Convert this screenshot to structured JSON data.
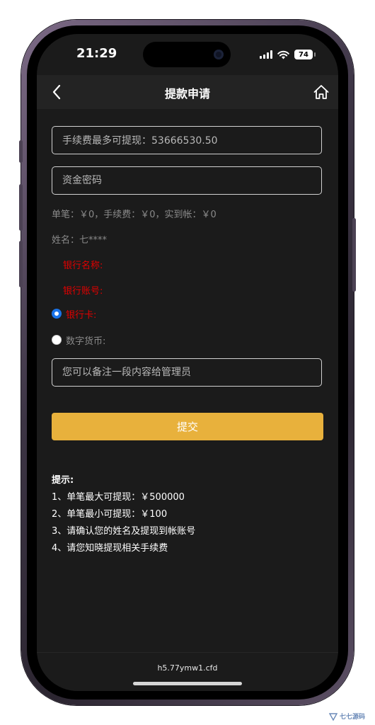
{
  "status_bar": {
    "time": "21:29",
    "battery": "74"
  },
  "header": {
    "title": "提款申请"
  },
  "form": {
    "max_withdraw_display": "手续费最多可提现：53666530.50",
    "password_placeholder": "资金密码",
    "fee_summary": "单笔：￥0，手续费：￥0，实到帐：￥0",
    "name_line": "姓名：七****",
    "bank_name_label": "银行名称:",
    "bank_account_label": "银行账号:",
    "options": [
      {
        "label": "银行卡:",
        "selected": true
      },
      {
        "label": "数字货币:",
        "selected": false
      }
    ],
    "remark_placeholder": "您可以备注一段内容给管理员",
    "submit_label": "提交"
  },
  "tips": {
    "title": "提示:",
    "items": [
      "1、单笔最大可提现：￥500000",
      "2、单笔最小可提现：￥100",
      "3、请确认您的姓名及提现到帐账号",
      "4、请您知晓提现相关手续费"
    ]
  },
  "bottom": {
    "url": "h5.77ymw1.cfd"
  },
  "watermark": {
    "text": "七七源码"
  },
  "colors": {
    "accent": "#e8b13c",
    "screen_bg": "#1b1b1b",
    "navbar_bg": "#232323",
    "warning_red": "#e00000",
    "radio_blue": "#1a73e8"
  }
}
